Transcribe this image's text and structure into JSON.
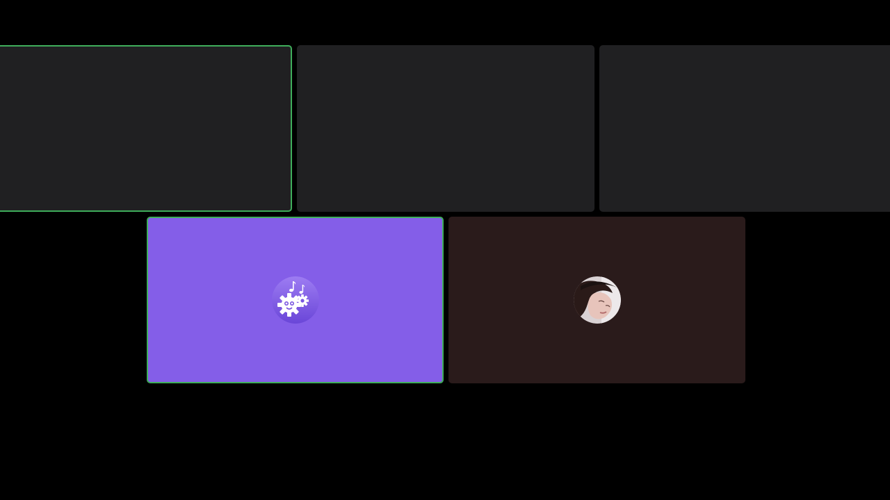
{
  "colors": {
    "page_background": "#000000",
    "tile_background": "#202022",
    "speaking_border": "#3fae5b",
    "bot_tile_background": "#845ee8",
    "photo_tile_background": "#2a1b1b"
  },
  "participants": [
    {
      "id": "p1",
      "speaking": true,
      "avatar": "none"
    },
    {
      "id": "p2",
      "speaking": false,
      "avatar": "none"
    },
    {
      "id": "p3",
      "speaking": false,
      "avatar": "none"
    },
    {
      "id": "p4",
      "speaking": true,
      "avatar": "music-bot-gears-icon"
    },
    {
      "id": "p5",
      "speaking": false,
      "avatar": "profile-photo"
    }
  ]
}
